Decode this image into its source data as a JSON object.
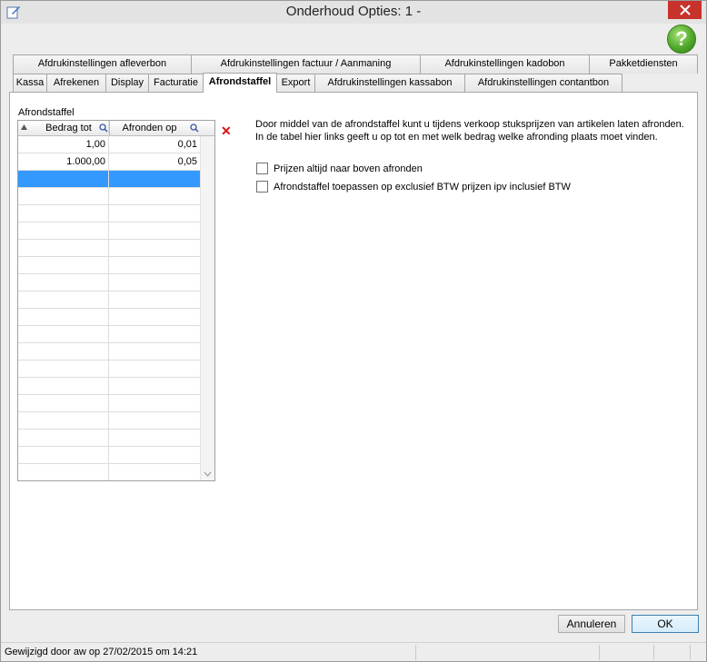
{
  "window": {
    "title": "Onderhoud Opties: 1 -"
  },
  "tabs_row1": [
    {
      "label": "Afdrukinstellingen afleverbon"
    },
    {
      "label": "Afdrukinstellingen factuur / Aanmaning"
    },
    {
      "label": "Afdrukinstellingen kadobon"
    },
    {
      "label": "Pakketdiensten"
    }
  ],
  "tabs_row2": [
    {
      "label": "Kassa"
    },
    {
      "label": "Afrekenen"
    },
    {
      "label": "Display"
    },
    {
      "label": "Facturatie"
    },
    {
      "label": "Afrondstaffel"
    },
    {
      "label": "Export"
    },
    {
      "label": "Afdrukinstellingen kassabon"
    },
    {
      "label": "Afdrukinstellingen contantbon"
    }
  ],
  "active_tab": "Afrondstaffel",
  "panel": {
    "group_label": "Afrondstaffel",
    "grid": {
      "columns": [
        "Bedrag tot",
        "Afronden op"
      ],
      "rows": [
        [
          "1,00",
          "0,01"
        ],
        [
          "1.000,00",
          "0,05"
        ]
      ],
      "selected_row": 2
    },
    "description_line1": "Door middel van de afrondstaffel kunt u tijdens verkoop stuksprijzen van artikelen laten afronden.",
    "description_line2": "In de tabel hier links geeft u op tot en met welk bedrag welke afronding plaats moet vinden.",
    "options": [
      {
        "label": "Prijzen altijd naar boven afronden",
        "checked": false
      },
      {
        "label": "Afrondstaffel toepassen op exclusief BTW prijzen ipv inclusief BTW",
        "checked": false
      }
    ]
  },
  "buttons": {
    "cancel": "Annuleren",
    "ok": "OK"
  },
  "status": {
    "text": "Gewijzigd door aw op 27/02/2015 om 14:21"
  },
  "colors": {
    "selection": "#3399ff",
    "close": "#c7322b",
    "help": "#4fa82a",
    "delete": "#dd1111"
  },
  "icons": [
    "app-icon",
    "close-icon",
    "help-icon",
    "sort-icon",
    "search-icon",
    "delete-icon",
    "scroll-down-icon"
  ]
}
